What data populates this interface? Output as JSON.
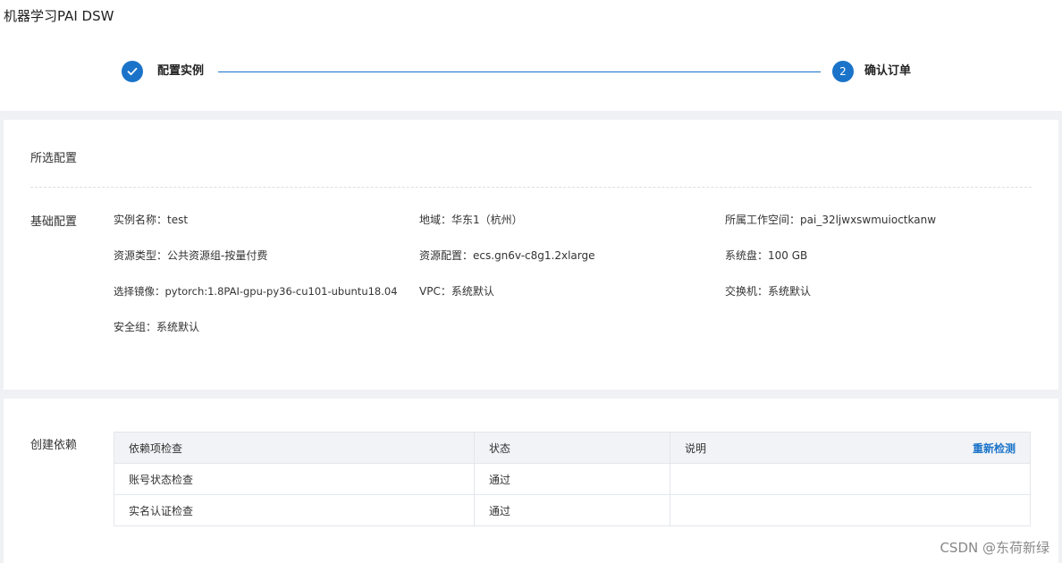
{
  "app": {
    "title": "机器学习PAI DSW"
  },
  "steps": [
    {
      "label": "配置实例",
      "state": "done",
      "number": ""
    },
    {
      "label": "确认订单",
      "state": "active",
      "number": "2"
    }
  ],
  "config": {
    "title": "所选配置",
    "group_label": "基础配置",
    "fields": [
      {
        "label": "实例名称：",
        "value": "test"
      },
      {
        "label": "地域：",
        "value": "华东1（杭州）"
      },
      {
        "label": "所属工作空间：",
        "value": "pai_32ljwxswmuioctkanw"
      },
      {
        "label": "资源类型：",
        "value": "公共资源组-按量付费"
      },
      {
        "label": "资源配置：",
        "value": "ecs.gn6v-c8g1.2xlarge"
      },
      {
        "label": "系统盘：",
        "value": "100 GB"
      },
      {
        "label": "选择镜像：",
        "value": "pytorch:1.8PAI-gpu-py36-cu101-ubuntu18.04"
      },
      {
        "label": "VPC：",
        "value": "系统默认"
      },
      {
        "label": "交换机：",
        "value": "系统默认"
      },
      {
        "label": "安全组：",
        "value": "系统默认"
      }
    ]
  },
  "dependencies": {
    "label": "创建依赖",
    "headers": [
      "依赖项检查",
      "状态",
      "说明"
    ],
    "recheck_label": "重新检测",
    "rows": [
      {
        "item": "账号状态检查",
        "status": "通过",
        "note": ""
      },
      {
        "item": "实名认证检查",
        "status": "通过",
        "note": ""
      }
    ]
  },
  "watermark": "CSDN @东荷新绿",
  "colors": {
    "accent": "#1a73c9",
    "pass": "#3a9e2f",
    "page_bg": "#f0f1f5"
  },
  "icons": {
    "done_step": "check-icon"
  }
}
